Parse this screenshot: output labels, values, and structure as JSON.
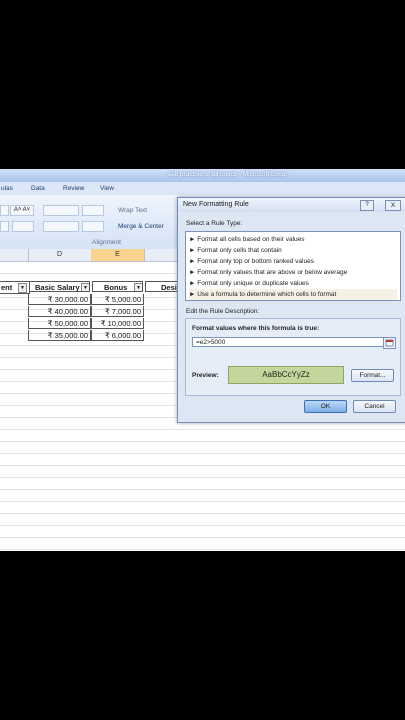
{
  "window": {
    "title": "self practise of all topics - Microsoft Excel"
  },
  "menu": {
    "items": [
      "ulas",
      "Data",
      "Review",
      "View"
    ]
  },
  "ribbon": {
    "wrap_text": "Wrap Text",
    "merge_center": "Merge & Center",
    "group_alignment": "Alignment"
  },
  "sheet": {
    "columns": [
      "D",
      "E"
    ],
    "headers": [
      "ent",
      "Basic Salary",
      "Bonus",
      "Desi"
    ],
    "rows": [
      {
        "salary": "₹ 30,000.00",
        "bonus": "₹ 5,000.00"
      },
      {
        "salary": "₹ 40,000.00",
        "bonus": "₹ 7,000.00"
      },
      {
        "salary": "₹ 50,000.00",
        "bonus": "₹ 10,000.00"
      },
      {
        "salary": "₹ 35,000.00",
        "bonus": "₹ 6,000.00"
      }
    ]
  },
  "dialog": {
    "title": "New Formatting Rule",
    "help": "?",
    "close": "X",
    "select_rule_type_label": "Select a Rule Type:",
    "rule_types": [
      "► Format all cells based on their values",
      "► Format only cells that contain",
      "► Format only top or bottom ranked values",
      "► Format only values that are above or below average",
      "► Format only unique or duplicate values",
      "► Use a formula to determine which cells to format"
    ],
    "edit_description_label": "Edit the Rule Description:",
    "formula_label": "Format values where this formula is true:",
    "formula_value": "=e2>5000",
    "preview_label": "Preview:",
    "preview_sample": "AaBbCcYyZz",
    "format_button": "Format...",
    "ok_button": "OK",
    "cancel_button": "Cancel"
  }
}
